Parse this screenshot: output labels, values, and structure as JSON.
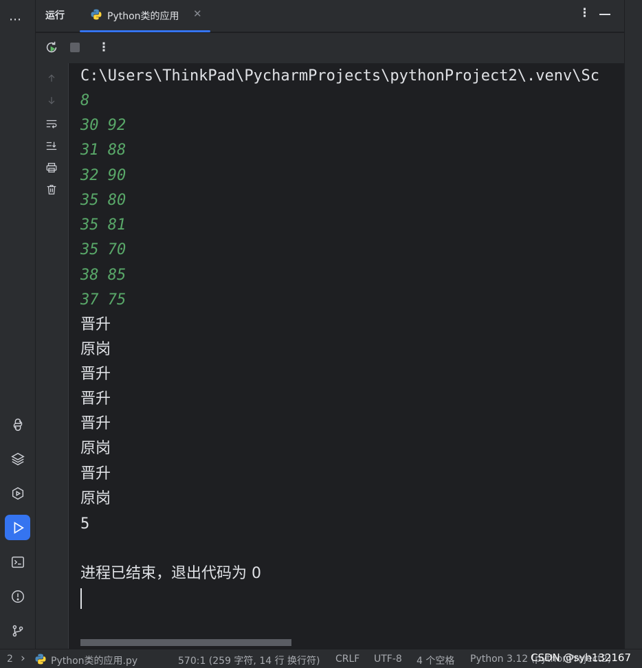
{
  "activity_bar": {
    "more_glyph": "⋯",
    "items": [
      {
        "name": "python-packages-icon",
        "active": false
      },
      {
        "name": "layers-icon",
        "active": false
      },
      {
        "name": "services-icon",
        "active": false
      },
      {
        "name": "run-icon",
        "active": true
      },
      {
        "name": "terminal-icon",
        "active": false
      },
      {
        "name": "problems-icon",
        "active": false
      },
      {
        "name": "git-icon",
        "active": false
      }
    ]
  },
  "header": {
    "run_label": "运行",
    "tab_label": "Python类的应用",
    "tab_close": "✕",
    "more_glyph": "⋮"
  },
  "toolbar": {
    "more_glyph": "⋮"
  },
  "console": {
    "command": "C:\\Users\\ThinkPad\\PycharmProjects\\pythonProject2\\.venv\\Sc",
    "input_lines": [
      "8",
      "30 92",
      "31 88",
      "32 90",
      "35 80",
      "35 81",
      "35 70",
      "38 85",
      "37 75"
    ],
    "output_lines": [
      "晋升",
      "原岗",
      "晋升",
      "晋升",
      "晋升",
      "原岗",
      "晋升",
      "原岗"
    ],
    "count": "5",
    "exit_message": "进程已结束，退出代码为 0"
  },
  "status_bar": {
    "left_fragment": "2",
    "chevron": "›",
    "file_name": "Python类的应用.py",
    "position": "570:1 (259 字符, 14 行 换行符)",
    "line_ending": "CRLF",
    "encoding": "UTF-8",
    "indent": "4 个空格",
    "interpreter": "Python 3.12 (pythonProject2)",
    "watermark": "CSDN @syh132167"
  },
  "colors": {
    "accent": "#3574f0",
    "input_green": "#59a869",
    "panel": "#2b2d30",
    "editor": "#1e1f22"
  }
}
